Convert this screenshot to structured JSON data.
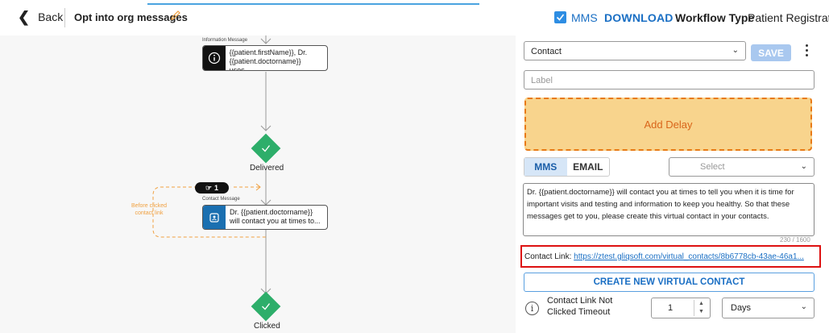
{
  "header": {
    "back_label": "Back",
    "page_title": "Opt into org messages",
    "mms_label": "MMS",
    "mms_checked": true,
    "download_label": "DOWNLOAD",
    "workflow_type_label": "Workflow Type",
    "workflow_type_value": "Patient Registration"
  },
  "flow": {
    "info_node": {
      "label": "Information Message",
      "text_line1": "{{patient.firstName}}, Dr.",
      "text_line2": "{{patient.doctorname}} uses..."
    },
    "delivered_label": "Delivered",
    "click_badge": "1",
    "before_clicked_line1": "Before clicked",
    "before_clicked_line2": "contact link",
    "contact_node": {
      "label": "Contact Message",
      "text_line1": "Dr. {{patient.doctorname}}",
      "text_line2": "will contact you at times to..."
    },
    "clicked_label": "Clicked",
    "colors": {
      "diamond": "#2dae6a",
      "dashed": "#f0a040"
    }
  },
  "panel": {
    "type_select_value": "Contact",
    "save_label": "SAVE",
    "label_placeholder": "Label",
    "add_delay_label": "Add Delay",
    "tabs": [
      {
        "label": "MMS",
        "active": true
      },
      {
        "label": "EMAIL",
        "active": false
      }
    ],
    "channel_select_placeholder": "Select",
    "message_text": "Dr. {{patient.doctorname}} will contact you at times to tell you when it is time for important visits and testing and information to keep you healthy.  So that these messages get to you, please create this virtual contact in your contacts.",
    "char_counter": "230 / 1600",
    "contact_link_label": "Contact Link:",
    "contact_link_url": "https://ztest.gliqsoft.com/virtual_contacts/8b6778cb-43ae-46a1...",
    "create_contact_label": "CREATE NEW VIRTUAL CONTACT",
    "timeout_label": "Contact Link Not Clicked Timeout",
    "timeout_value": "1",
    "timeout_unit": "Days"
  }
}
